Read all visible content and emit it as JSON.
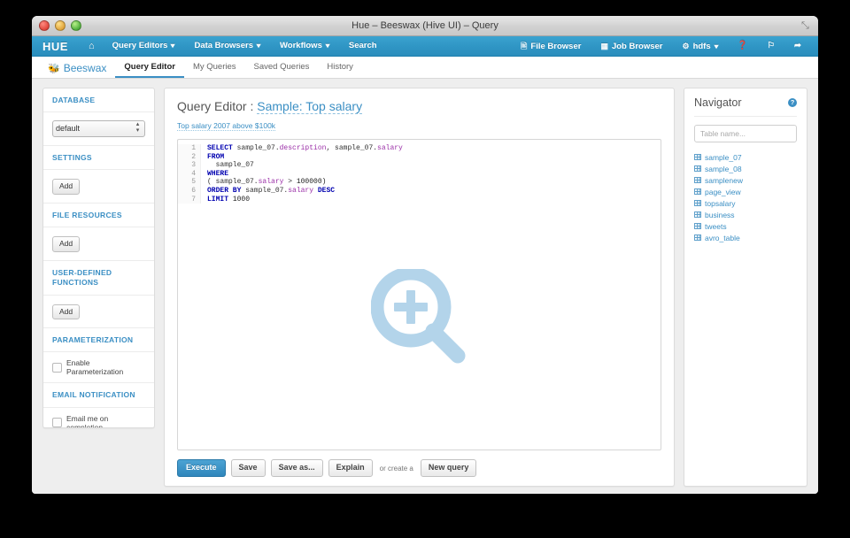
{
  "window": {
    "title": "Hue – Beeswax (Hive UI) – Query"
  },
  "navbar": {
    "logo": "HUE",
    "home_icon": "home-icon",
    "items": [
      {
        "label": "Query Editors",
        "caret": "▾"
      },
      {
        "label": "Data Browsers",
        "caret": "▾"
      },
      {
        "label": "Workflows",
        "caret": "▾"
      },
      {
        "label": "Search",
        "caret": ""
      }
    ],
    "right": [
      {
        "label": "File Browser",
        "icon": "document-icon"
      },
      {
        "label": "Job Browser",
        "icon": "grid-icon"
      },
      {
        "label": "hdfs",
        "icon": "gear-icon",
        "caret": "▾"
      }
    ],
    "help_icon": "question-circle-icon",
    "flag_icon": "flag-icon",
    "logout_icon": "logout-icon"
  },
  "subnav": {
    "brand": "Beeswax",
    "brand_icon": "bee-icon",
    "tabs": [
      {
        "label": "Query Editor",
        "active": true
      },
      {
        "label": "My Queries",
        "active": false
      },
      {
        "label": "Saved Queries",
        "active": false
      },
      {
        "label": "History",
        "active": false
      }
    ]
  },
  "sidebar": {
    "sections": [
      {
        "heading": "DATABASE",
        "type": "select",
        "value": "default",
        "options": [
          "default"
        ]
      },
      {
        "heading": "SETTINGS",
        "type": "button",
        "button": "Add"
      },
      {
        "heading": "FILE RESOURCES",
        "type": "button",
        "button": "Add"
      },
      {
        "heading": "USER-DEFINED FUNCTIONS",
        "type": "button",
        "button": "Add"
      },
      {
        "heading": "PARAMETERIZATION",
        "type": "checkbox",
        "checkbox": "Enable Parameterization",
        "checked": false
      },
      {
        "heading": "EMAIL NOTIFICATION",
        "type": "checkbox",
        "checkbox": "Email me on completion.",
        "checked": false
      }
    ],
    "help_icon": "question-circle-icon"
  },
  "editor": {
    "title_prefix": "Query Editor : ",
    "query_name": "Sample: Top salary",
    "description": "Top salary 2007 above $100k",
    "line_numbers": [
      1,
      2,
      3,
      4,
      5,
      6,
      7
    ],
    "sql_lines": [
      [
        {
          "t": "SELECT",
          "c": "k"
        },
        {
          "t": " sample_07.",
          "c": "id"
        },
        {
          "t": "description",
          "c": "fld"
        },
        {
          "t": ", sample_07.",
          "c": "id"
        },
        {
          "t": "salary",
          "c": "fld"
        }
      ],
      [
        {
          "t": "FROM",
          "c": "k"
        }
      ],
      [
        {
          "t": "  sample_07",
          "c": "id"
        }
      ],
      [
        {
          "t": "WHERE",
          "c": "k"
        }
      ],
      [
        {
          "t": "( sample_07.",
          "c": "id"
        },
        {
          "t": "salary",
          "c": "fld"
        },
        {
          "t": " > ",
          "c": "op"
        },
        {
          "t": "100000)",
          "c": "num"
        }
      ],
      [
        {
          "t": "ORDER BY",
          "c": "k"
        },
        {
          "t": " sample_07.",
          "c": "id"
        },
        {
          "t": "salary",
          "c": "fld"
        },
        {
          "t": " ",
          "c": "id"
        },
        {
          "t": "DESC",
          "c": "k"
        }
      ],
      [
        {
          "t": "LIMIT",
          "c": "k"
        },
        {
          "t": " 1000",
          "c": "num"
        }
      ]
    ],
    "cursor_icon": "magnifier-zoom-in-icon",
    "cursor_icon_color": "#b3d4ea",
    "actions": {
      "execute": "Execute",
      "save": "Save",
      "save_as": "Save as...",
      "explain": "Explain",
      "or_create": "or create a",
      "new_query": "New query"
    }
  },
  "navigator": {
    "title": "Navigator",
    "help_icon": "question-circle-icon",
    "search_placeholder": "Table name...",
    "search_value": "",
    "tables": [
      "sample_07",
      "sample_08",
      "samplenew",
      "page_view",
      "topsalary",
      "business",
      "tweets",
      "avro_table"
    ]
  },
  "theme": {
    "brand_blue": "#3b8fc4",
    "navbar_blue": "#2f95c4",
    "page_bg": "#eeeeee",
    "keyword_color": "#0000b0",
    "field_color": "#9b30a8"
  }
}
